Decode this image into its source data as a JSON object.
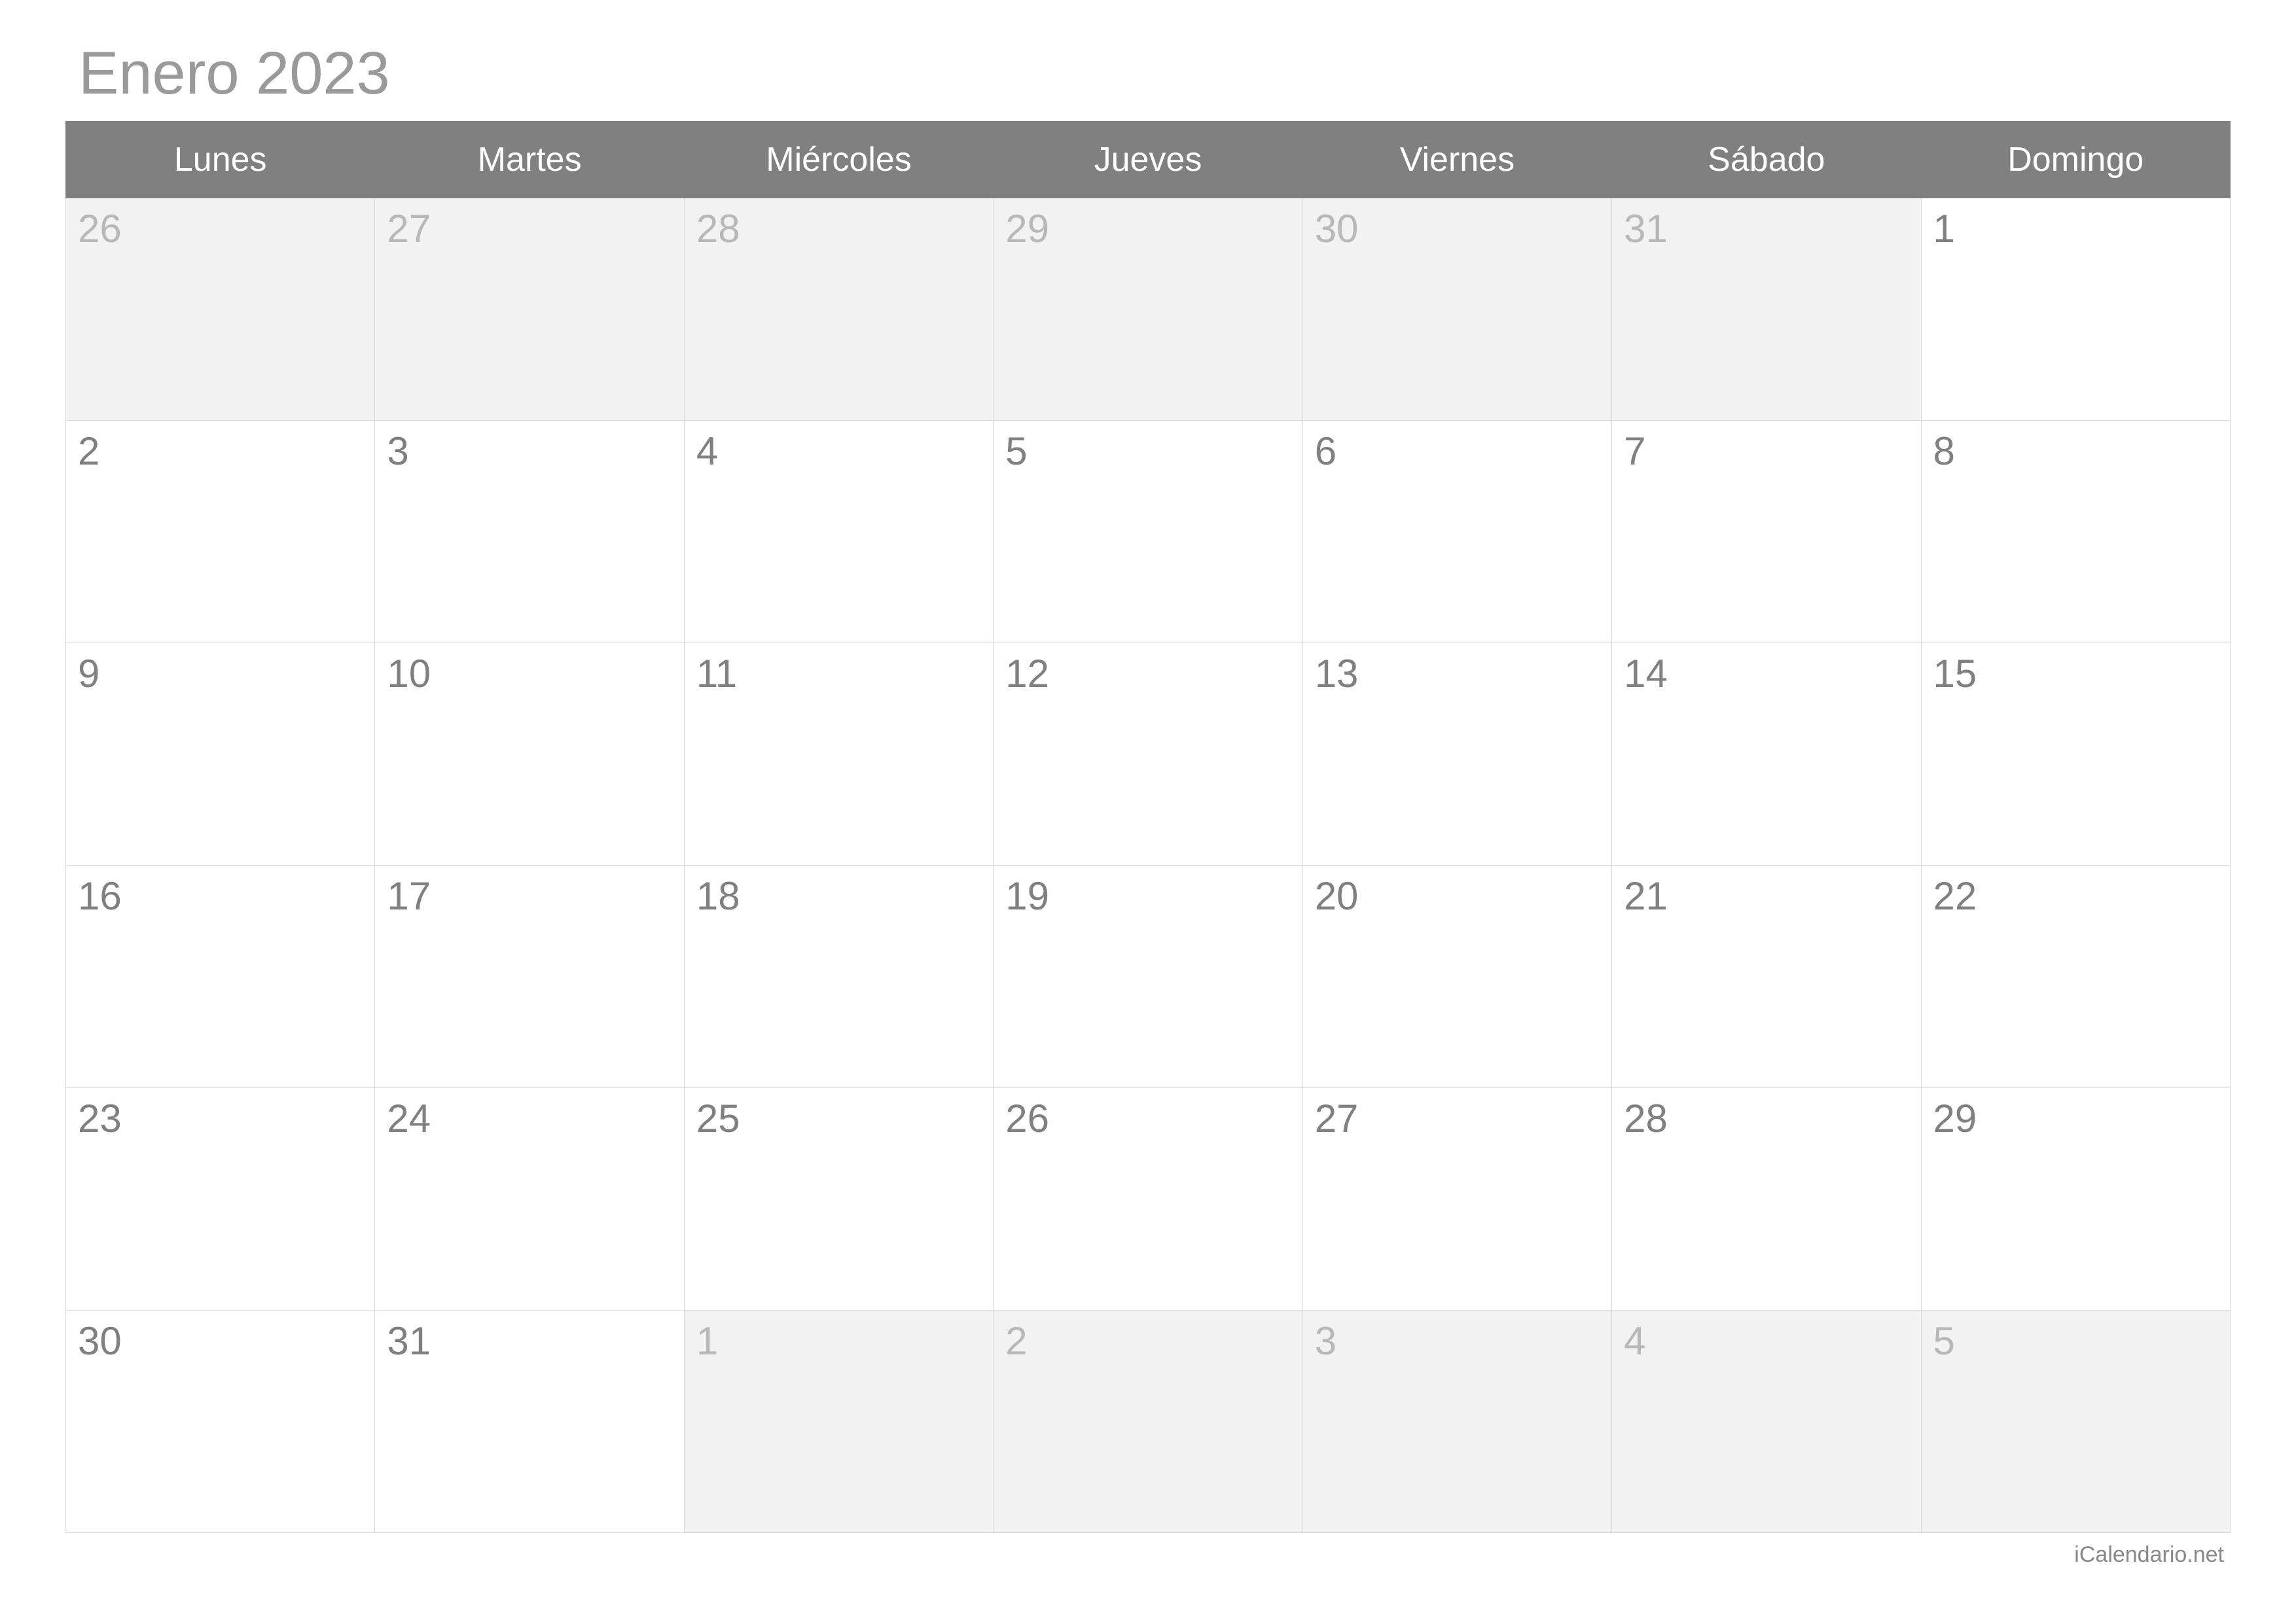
{
  "title": "Enero 2023",
  "footer": "iCalendario.net",
  "weekdays": [
    "Lunes",
    "Martes",
    "Miércoles",
    "Jueves",
    "Viernes",
    "Sábado",
    "Domingo"
  ],
  "weeks": [
    [
      {
        "day": "26",
        "other": true
      },
      {
        "day": "27",
        "other": true
      },
      {
        "day": "28",
        "other": true
      },
      {
        "day": "29",
        "other": true
      },
      {
        "day": "30",
        "other": true
      },
      {
        "day": "31",
        "other": true
      },
      {
        "day": "1",
        "other": false
      }
    ],
    [
      {
        "day": "2",
        "other": false
      },
      {
        "day": "3",
        "other": false
      },
      {
        "day": "4",
        "other": false
      },
      {
        "day": "5",
        "other": false
      },
      {
        "day": "6",
        "other": false
      },
      {
        "day": "7",
        "other": false
      },
      {
        "day": "8",
        "other": false
      }
    ],
    [
      {
        "day": "9",
        "other": false
      },
      {
        "day": "10",
        "other": false
      },
      {
        "day": "11",
        "other": false
      },
      {
        "day": "12",
        "other": false
      },
      {
        "day": "13",
        "other": false
      },
      {
        "day": "14",
        "other": false
      },
      {
        "day": "15",
        "other": false
      }
    ],
    [
      {
        "day": "16",
        "other": false
      },
      {
        "day": "17",
        "other": false
      },
      {
        "day": "18",
        "other": false
      },
      {
        "day": "19",
        "other": false
      },
      {
        "day": "20",
        "other": false
      },
      {
        "day": "21",
        "other": false
      },
      {
        "day": "22",
        "other": false
      }
    ],
    [
      {
        "day": "23",
        "other": false
      },
      {
        "day": "24",
        "other": false
      },
      {
        "day": "25",
        "other": false
      },
      {
        "day": "26",
        "other": false
      },
      {
        "day": "27",
        "other": false
      },
      {
        "day": "28",
        "other": false
      },
      {
        "day": "29",
        "other": false
      }
    ],
    [
      {
        "day": "30",
        "other": false
      },
      {
        "day": "31",
        "other": false
      },
      {
        "day": "1",
        "other": true
      },
      {
        "day": "2",
        "other": true
      },
      {
        "day": "3",
        "other": true
      },
      {
        "day": "4",
        "other": true
      },
      {
        "day": "5",
        "other": true
      }
    ]
  ]
}
